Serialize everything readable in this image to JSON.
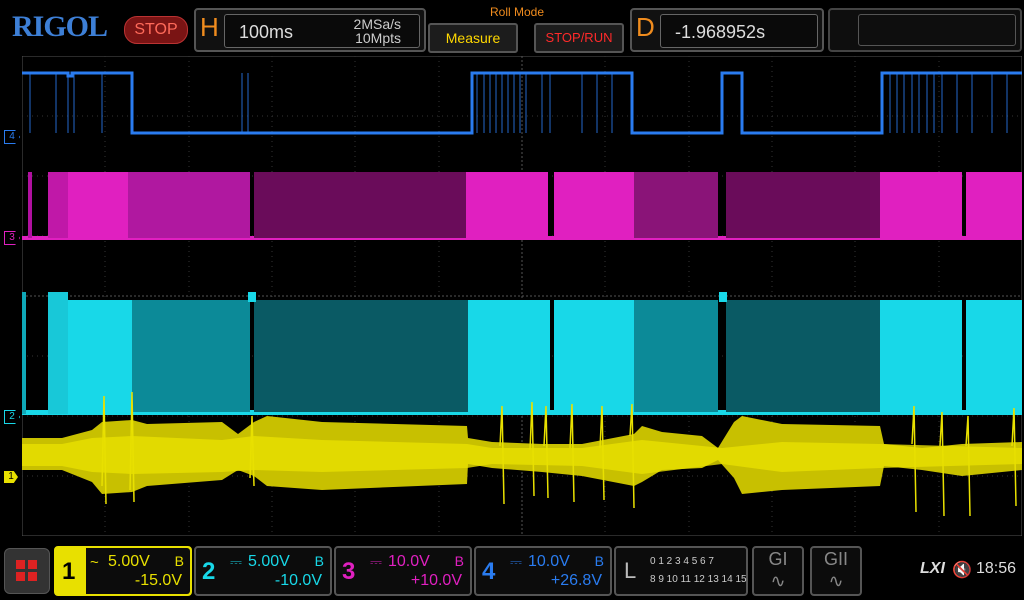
{
  "header": {
    "logo": "RIGOL",
    "run_state": "STOP",
    "horizontal": {
      "letter": "H",
      "timebase": "100ms",
      "sample_rate": "2MSa/s",
      "memory_depth": "10Mpts"
    },
    "mode": "Roll Mode",
    "measure_label": "Measure",
    "stop_run_label": "STOP/RUN",
    "delay": {
      "letter": "D",
      "value": "-1.968952s"
    }
  },
  "channels": [
    {
      "num": "1",
      "coupling": "~",
      "scale": "5.00V",
      "bw": "B",
      "offset": "-15.0V",
      "color": "#e8e000",
      "marker": "1"
    },
    {
      "num": "2",
      "coupling": "⎓",
      "scale": "5.00V",
      "bw": "B",
      "offset": "-10.0V",
      "color": "#18d8e8",
      "marker": "2"
    },
    {
      "num": "3",
      "coupling": "⎓",
      "scale": "10.0V",
      "bw": "B",
      "offset": "+10.0V",
      "color": "#e020c0",
      "marker": "3"
    },
    {
      "num": "4",
      "coupling": "⎓",
      "scale": "10.0V",
      "bw": "B",
      "offset": "+26.8V",
      "color": "#2a7cf0",
      "marker": "4"
    }
  ],
  "logic": {
    "label": "L",
    "row1": "0 1 2 3  4 5 6 7",
    "row2": "8 9 10 11 12 13 14 15"
  },
  "generators": {
    "g1": "GI",
    "g2": "GII"
  },
  "status": {
    "lxi": "LXI",
    "speaker_icon": "speaker-muted-icon",
    "time": "18:56"
  },
  "icons": {
    "menu": "grid-menu-icon",
    "trigger": "trigger-position-icon"
  }
}
